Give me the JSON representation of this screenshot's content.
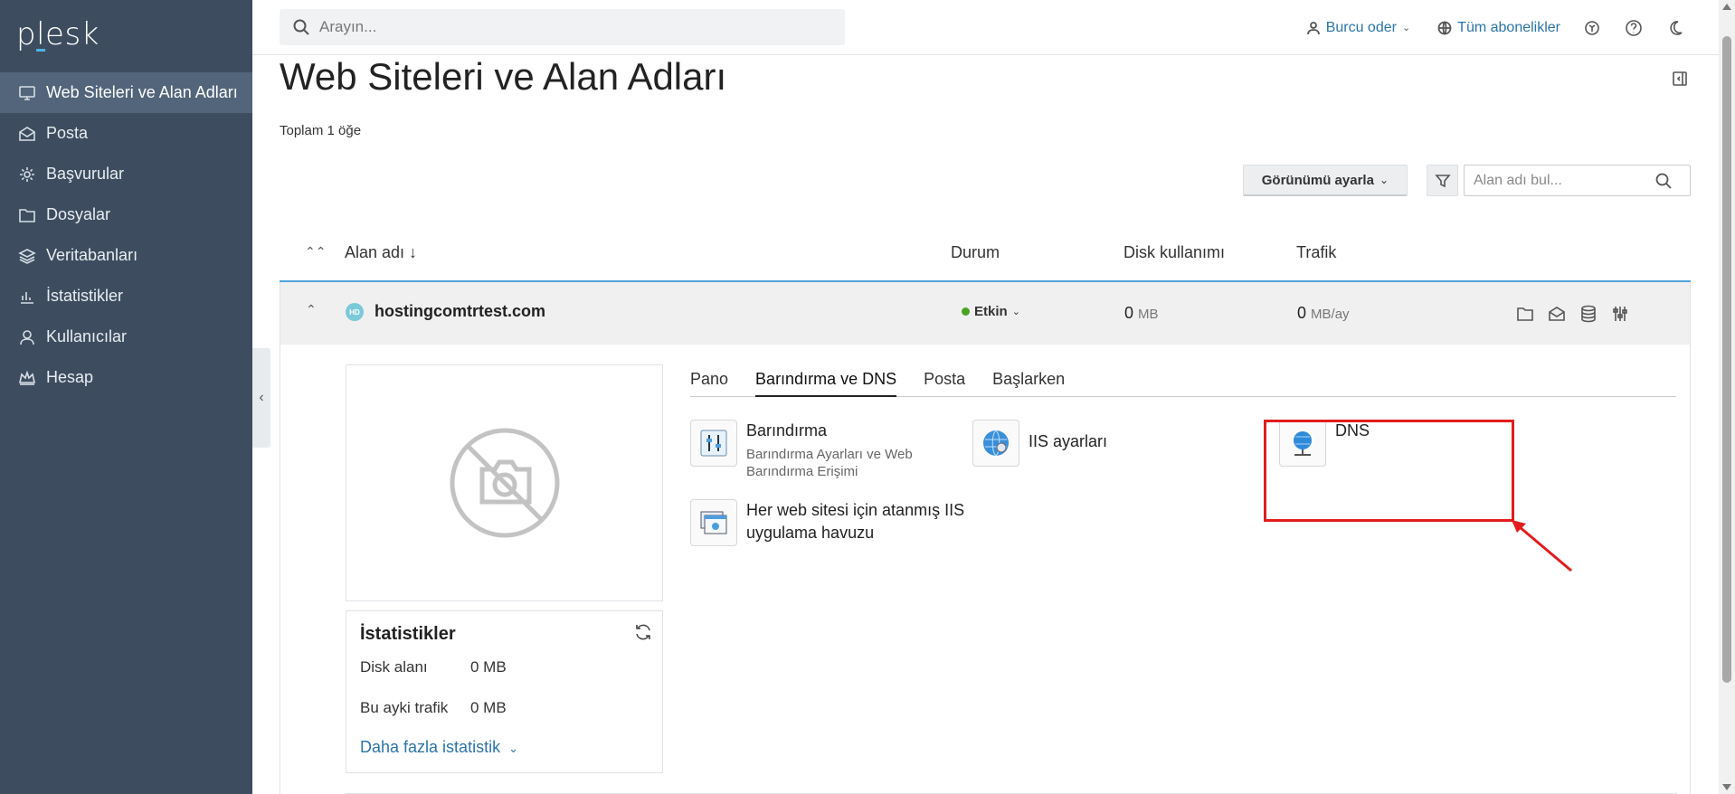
{
  "logo": "plesk",
  "sidebar": {
    "items": [
      {
        "label": "Web Siteleri ve Alan Adları",
        "icon": "monitor-icon"
      },
      {
        "label": "Posta",
        "icon": "mail-icon"
      },
      {
        "label": "Başvurular",
        "icon": "gear-icon"
      },
      {
        "label": "Dosyalar",
        "icon": "folder-icon"
      },
      {
        "label": "Veritabanları",
        "icon": "database-icon"
      },
      {
        "label": "İstatistikler",
        "icon": "chart-icon"
      },
      {
        "label": "Kullanıcılar",
        "icon": "user-icon"
      },
      {
        "label": "Hesap",
        "icon": "crown-icon"
      }
    ]
  },
  "topbar": {
    "search_placeholder": "Arayın...",
    "user_label": "Burcu oder",
    "subscriptions_label": "Tüm abonelikler"
  },
  "page": {
    "title": "Web Siteleri ve Alan Adları",
    "total": "Toplam 1 öğe",
    "view_button": "Görünümü ayarla",
    "domain_search_placeholder": "Alan adı bul..."
  },
  "table": {
    "columns": {
      "domain": "Alan adı ↓",
      "status": "Durum",
      "disk": "Disk kullanımı",
      "traffic": "Trafik"
    },
    "row": {
      "domain": "hostingcomtrtest.com",
      "domain_icon_text": "HD",
      "status": "Etkin",
      "disk_value": "0",
      "disk_unit": "MB",
      "traffic_value": "0",
      "traffic_unit": "MB/ay"
    }
  },
  "stats": {
    "title": "İstatistikler",
    "disk_label": "Disk alanı",
    "disk_value": "0 MB",
    "traffic_label": "Bu ayki trafik",
    "traffic_value": "0 MB",
    "more": "Daha fazla istatistik"
  },
  "tabs": [
    "Pano",
    "Barındırma ve DNS",
    "Posta",
    "Başlarken"
  ],
  "tiles": {
    "hosting_title": "Barındırma",
    "hosting_desc_1": "Barındırma Ayarları ve Web",
    "hosting_desc_2": "Barındırma Erişimi",
    "iis_title": "IIS ayarları",
    "dns_title": "DNS",
    "apppool_title_1": "Her web sitesi için atanmış IIS",
    "apppool_title_2": "uygulama havuzu"
  },
  "colors": {
    "sidebar_bg": "#3d4d5f",
    "accent": "#2a74a8",
    "status_active": "#4aa321",
    "highlight": "#e21d1d"
  }
}
